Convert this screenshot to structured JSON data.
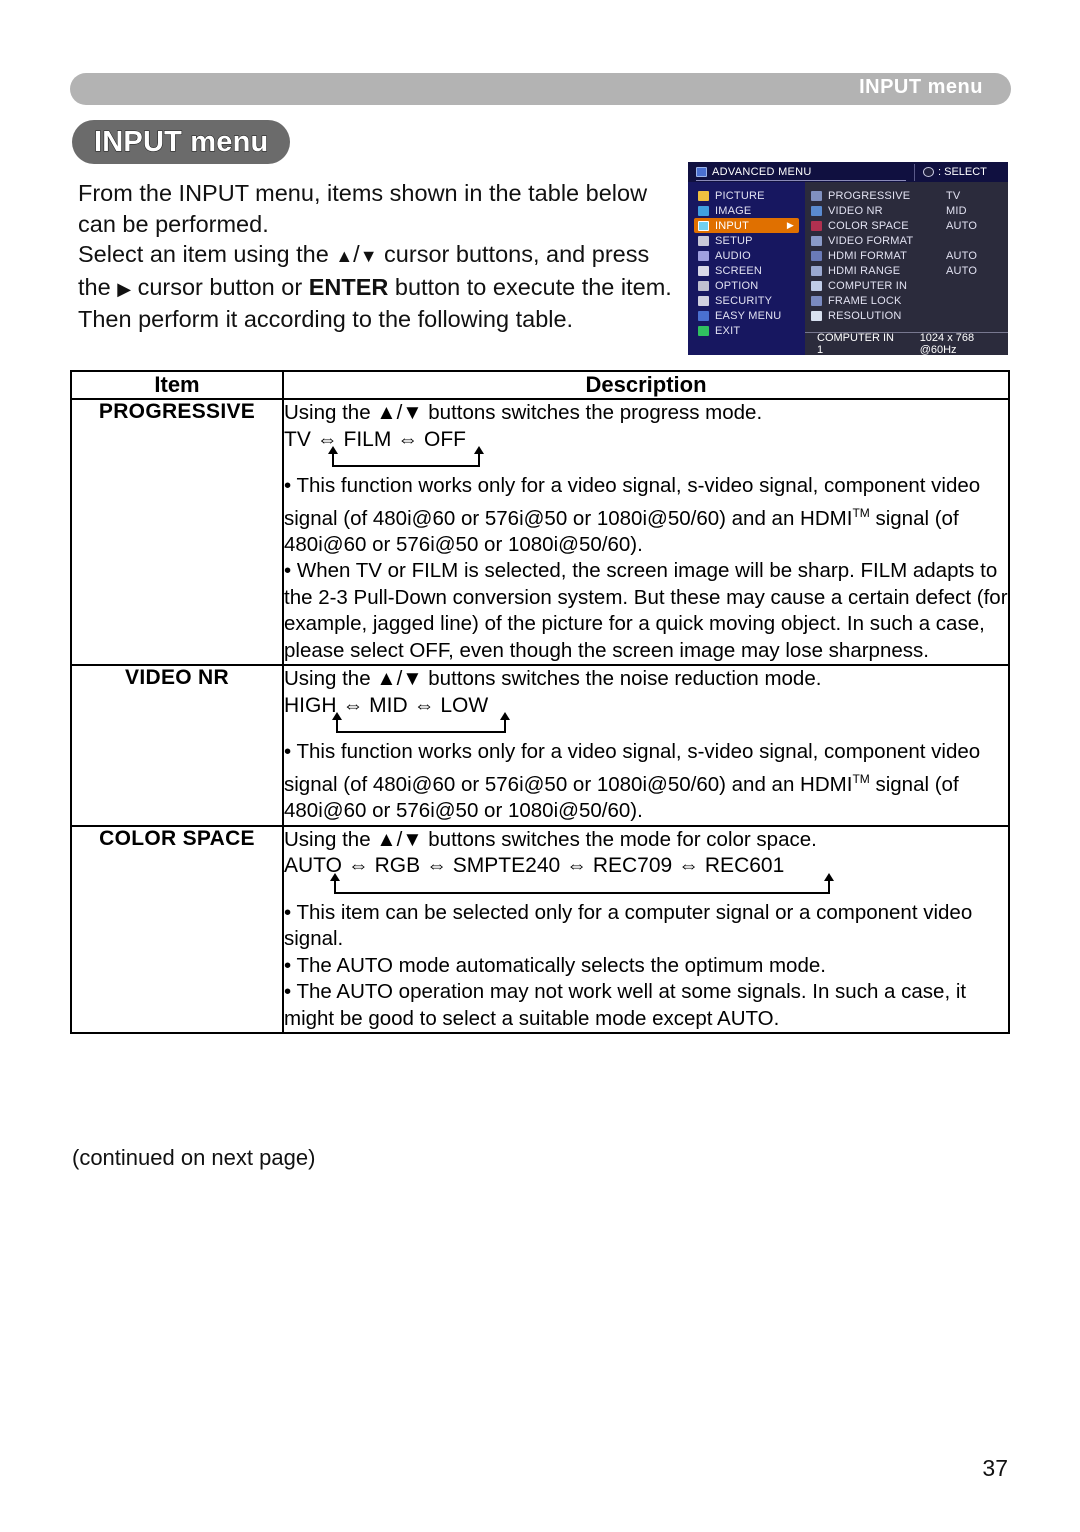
{
  "header": {
    "running_head": "INPUT menu",
    "title_badge": "INPUT menu"
  },
  "intro": {
    "line1": "From the INPUT menu, items shown in the table",
    "line2": "below can be performed.",
    "line3a": "Select an item using the ",
    "line3b": " cursor buttons, and",
    "line4a": "press the ",
    "line4b": " cursor button or ",
    "line4_bold": "ENTER",
    "line4c": " button to",
    "line5": "execute the item. Then perform it according to the",
    "line6": "following table."
  },
  "osd": {
    "title": "ADVANCED MENU",
    "select_label": ": SELECT",
    "left_items": [
      {
        "label": "PICTURE",
        "active": false
      },
      {
        "label": "IMAGE",
        "active": false
      },
      {
        "label": "INPUT",
        "active": true
      },
      {
        "label": "SETUP",
        "active": false
      },
      {
        "label": "AUDIO",
        "active": false
      },
      {
        "label": "SCREEN",
        "active": false
      },
      {
        "label": "OPTION",
        "active": false
      },
      {
        "label": "SECURITY",
        "active": false
      },
      {
        "label": "EASY MENU",
        "active": false
      },
      {
        "label": "EXIT",
        "active": false
      }
    ],
    "right_items": [
      {
        "label": "PROGRESSIVE",
        "value": "TV"
      },
      {
        "label": "VIDEO NR",
        "value": "MID"
      },
      {
        "label": "COLOR SPACE",
        "value": "AUTO"
      },
      {
        "label": "VIDEO FORMAT",
        "value": ""
      },
      {
        "label": "HDMI FORMAT",
        "value": "AUTO"
      },
      {
        "label": "HDMI RANGE",
        "value": "AUTO"
      },
      {
        "label": "COMPUTER IN",
        "value": ""
      },
      {
        "label": "FRAME LOCK",
        "value": ""
      },
      {
        "label": "RESOLUTION",
        "value": ""
      }
    ],
    "status_source": "COMPUTER IN 1",
    "status_signal": "1024 x 768 @60Hz",
    "accent_color": "#e07000",
    "sidebar_color": "#171760",
    "panel_color": "#2b2b3c"
  },
  "table": {
    "header_item": "Item",
    "header_description": "Description",
    "rows": [
      {
        "item": "PROGRESSIVE",
        "intro": "Using the ▲/▼ buttons switches the progress mode.",
        "cycle": "TV ⇔ FILM ⇔ OFF",
        "bullets": [
          "• This function works only for a video signal, s-video signal, component video signal (of 480i@60 or 576i@50 or 1080i@50/60) and an HDMI™ signal (of 480i@60 or 576i@50 or 1080i@50/60).",
          "• When TV or FILM is selected, the screen image will be sharp. FILM adapts to the 2-3 Pull-Down conversion system. But these may cause a certain defect (for example, jagged line) of the picture for a quick moving object. In such a case, please select OFF, even though the screen image may lose sharpness."
        ]
      },
      {
        "item": "VIDEO NR",
        "intro": "Using the ▲/▼ buttons switches the noise reduction mode.",
        "cycle": "HIGH ⇔ MID ⇔ LOW",
        "bullets": [
          "• This function works only for a video signal, s-video signal, component video signal (of 480i@60 or 576i@50 or 1080i@50/60) and an HDMI™ signal (of 480i@60 or 576i@50 or 1080i@50/60)."
        ]
      },
      {
        "item": "COLOR SPACE",
        "intro": "Using the ▲/▼ buttons switches the mode for color space.",
        "cycle": "AUTO ⇔ RGB ⇔ SMPTE240 ⇔ REC709 ⇔ REC601",
        "bullets": [
          "• This item can be selected only for a computer signal or a component video signal.",
          "• The AUTO mode automatically selects the optimum mode.",
          "• The AUTO operation may not work well at some signals. In such a case, it might be good to select a suitable mode except AUTO."
        ]
      }
    ]
  },
  "footer": {
    "continued": "(continued on next page)",
    "page_number": "37"
  }
}
